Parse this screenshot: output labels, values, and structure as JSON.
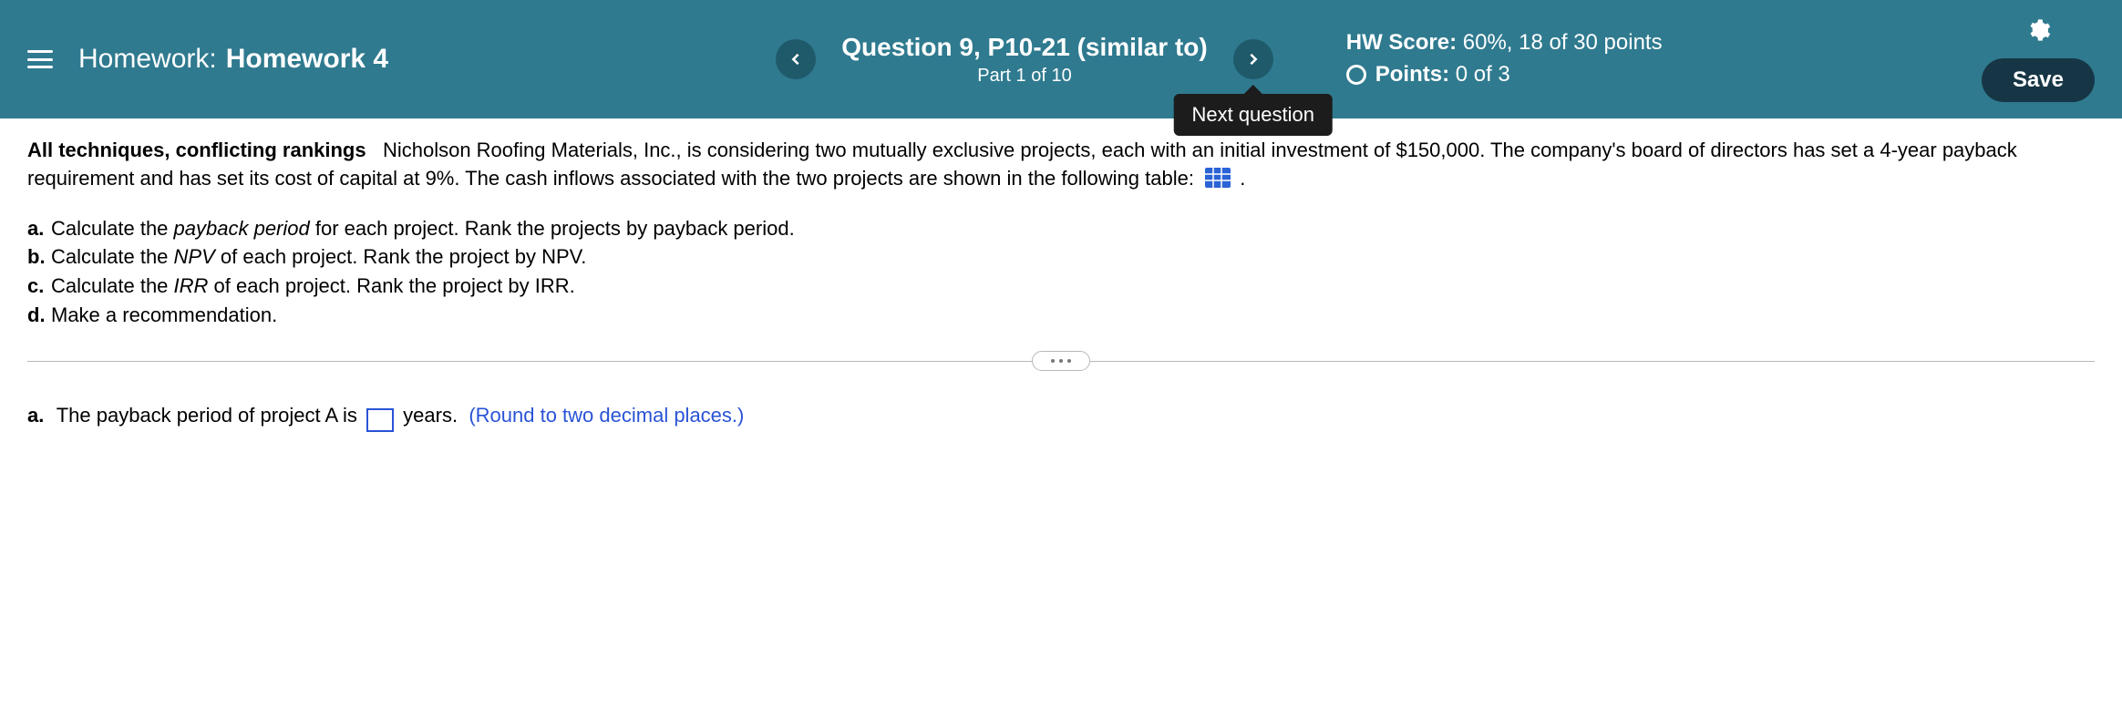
{
  "header": {
    "homework_prefix": "Homework:",
    "homework_title": "Homework 4",
    "question_title": "Question 9, P10-21 (similar to)",
    "question_part": "Part 1 of 10",
    "tooltip": "Next question",
    "hw_score_label": "HW Score:",
    "hw_score_value": "60%, 18 of 30 points",
    "points_label": "Points:",
    "points_value": "0 of 3",
    "save_label": "Save"
  },
  "problem": {
    "lead": "All techniques, conflicting rankings",
    "body_1": "Nicholson Roofing Materials, Inc., is considering two mutually exclusive projects, each with an initial investment of $150,000.  The company's board of directors has set a 4-year payback requirement and has set its cost of capital at 9%.  The cash inflows associated with the two projects are shown in the following table:",
    "tasks": {
      "a": {
        "marker": "a.",
        "t1": "Calculate the ",
        "metric": "payback period",
        "t2": " for each project.  Rank the projects by payback period."
      },
      "b": {
        "marker": "b.",
        "t1": "Calculate the ",
        "metric": "NPV",
        "t2": " of each project.  Rank the project by NPV."
      },
      "c": {
        "marker": "c.",
        "t1": "Calculate the ",
        "metric": "IRR",
        "t2": " of each project.  Rank the project by IRR."
      },
      "d": {
        "marker": "d.",
        "t1": "Make a recommendation."
      }
    }
  },
  "answer": {
    "marker": "a.",
    "before": "The payback period of project A is",
    "after": "years.",
    "round_note": "(Round to two decimal places.)",
    "value": ""
  }
}
